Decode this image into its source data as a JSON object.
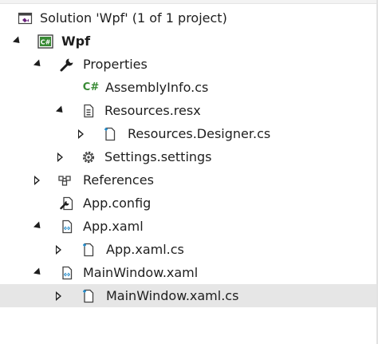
{
  "tree": {
    "rows": [
      {
        "label": "Solution 'Wpf' (1 of 1 project)",
        "icon": "solution-icon"
      },
      {
        "label": "Wpf",
        "icon": "csharp-project-icon"
      },
      {
        "label": "Properties",
        "icon": "wrench-icon"
      },
      {
        "label": "AssemblyInfo.cs",
        "icon": "csharp-file-icon"
      },
      {
        "label": "Resources.resx",
        "icon": "resource-file-icon"
      },
      {
        "label": "Resources.Designer.cs",
        "icon": "file-icon"
      },
      {
        "label": "Settings.settings",
        "icon": "gear-icon"
      },
      {
        "label": "References",
        "icon": "references-icon"
      },
      {
        "label": "App.config",
        "icon": "config-file-icon"
      },
      {
        "label": "App.xaml",
        "icon": "xaml-file-icon"
      },
      {
        "label": "App.xaml.cs",
        "icon": "file-icon"
      },
      {
        "label": "MainWindow.xaml",
        "icon": "xaml-file-icon"
      },
      {
        "label": "MainWindow.xaml.cs",
        "icon": "file-icon"
      }
    ],
    "csharp_badge": "C#",
    "selected_row": "MainWindow.xaml.cs"
  },
  "colors": {
    "solution_icon": "#68217a",
    "csharp_green": "#388a34",
    "file_accent": "#1e88c8",
    "selected_bg": "#e6e6e6"
  }
}
